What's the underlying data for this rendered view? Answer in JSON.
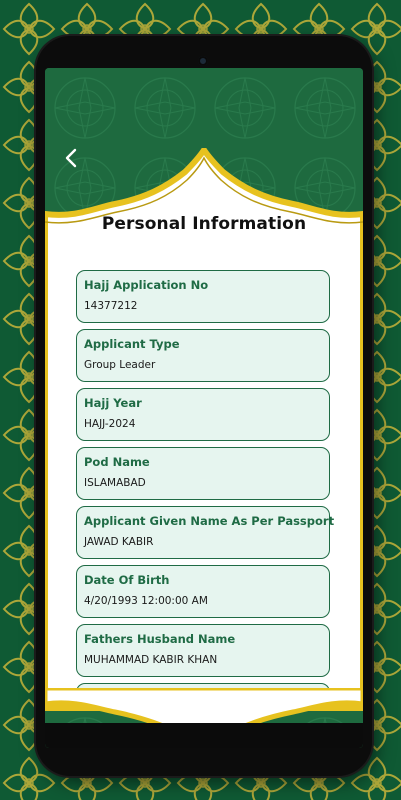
{
  "page": {
    "title": "Personal Information"
  },
  "nav": {
    "back_icon": "chevron-left-icon"
  },
  "colors": {
    "background_green": "#0f5a34",
    "gold": "#e7c21f",
    "field_border": "#1f6b45",
    "field_fill": "#e6f5ef",
    "label_color": "#1f6b45"
  },
  "fields": [
    {
      "label": "Hajj Application No",
      "value": "14377212"
    },
    {
      "label": "Applicant Type",
      "value": "Group Leader"
    },
    {
      "label": "Hajj Year",
      "value": "HAJJ-2024"
    },
    {
      "label": "Pod Name",
      "value": "ISLAMABAD"
    },
    {
      "label": "Applicant Given Name As Per Passport",
      "value": "JAWAD KABIR"
    },
    {
      "label": "Date Of Birth",
      "value": "4/20/1993 12:00:00 AM"
    },
    {
      "label": "Fathers Husband Name",
      "value": "MUHAMMAD KABIR KHAN"
    }
  ]
}
